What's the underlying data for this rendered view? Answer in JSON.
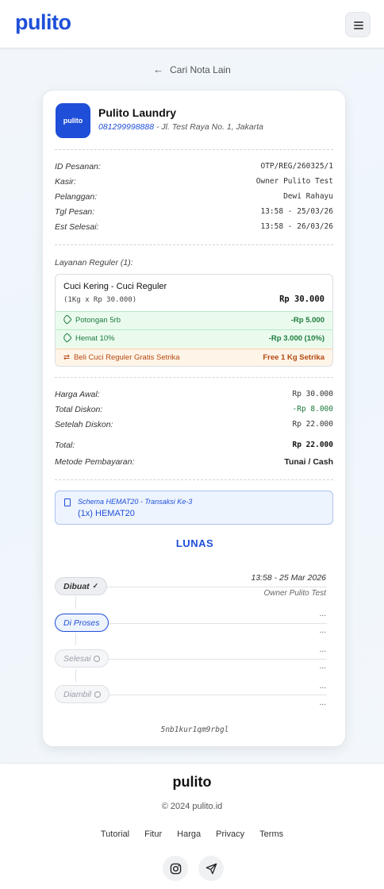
{
  "header": {
    "logo": "pulito"
  },
  "back_link": "Cari Nota Lain",
  "shop": {
    "logo_text": "pulito",
    "name": "Pulito Laundry",
    "phone": "081299998888",
    "address": " - Jl. Test Raya No. 1, Jakarta"
  },
  "order": {
    "id_label": "ID Pesanan:",
    "id_value": "OTP/REG/260325/1",
    "cashier_label": "Kasir:",
    "cashier_value": "Owner Pulito Test",
    "customer_label": "Pelanggan:",
    "customer_value": "Dewi Rahayu",
    "date_label": "Tgl Pesan:",
    "date_value": "13:58 - 25/03/26",
    "est_label": "Est Selesai:",
    "est_value": "13:58 - 26/03/26"
  },
  "service": {
    "title": "Layanan Reguler (1):",
    "name": "Cuci Kering - Cuci Reguler",
    "qty": "(1Kg x Rp 30.000)",
    "price": "Rp 30.000",
    "discounts": [
      {
        "label": "Potongan 5rb",
        "amount": "-Rp 5.000"
      },
      {
        "label": "Hemat 10%",
        "amount": "-Rp 3.000 (10%)"
      }
    ],
    "promo_label": "Beli Cuci Reguler Gratis Setrika",
    "promo_value": "Free 1 Kg Setrika"
  },
  "totals": {
    "original_label": "Harga Awal:",
    "original_value": "Rp 30.000",
    "discount_label": "Total Diskon:",
    "discount_value": "-Rp 8.000",
    "after_label": "Setelah Diskon:",
    "after_value": "Rp 22.000",
    "total_label": "Total:",
    "total_value": "Rp 22.000",
    "payment_label": "Metode Pembayaran:",
    "payment_value": "Tunai / Cash"
  },
  "scheme": {
    "title": "Schema HEMAT20 - Transaksi Ke-3",
    "value": "(1x) HEMAT20"
  },
  "status": "LUNAS",
  "timeline": [
    {
      "label": "Dibuat",
      "time": "13:58 - 25 Mar 2026",
      "user": "Owner Pulito Test"
    },
    {
      "label": "Di Proses",
      "time": "...",
      "user": "..."
    },
    {
      "label": "Selesai",
      "time": "...",
      "user": "..."
    },
    {
      "label": "Diambil",
      "time": "...",
      "user": "..."
    }
  ],
  "code": "5nb1kur1qm9rbgl",
  "footer": {
    "logo": "pulito",
    "copyright": "© 2024 pulito.id",
    "links": [
      "Tutorial",
      "Fitur",
      "Harga",
      "Privacy",
      "Terms"
    ],
    "social": [
      "instagram-icon",
      "send-icon"
    ]
  },
  "colors": {
    "brand": "#1f4fd8",
    "discount": "#1d7a3d",
    "promo": "#b34a12"
  }
}
